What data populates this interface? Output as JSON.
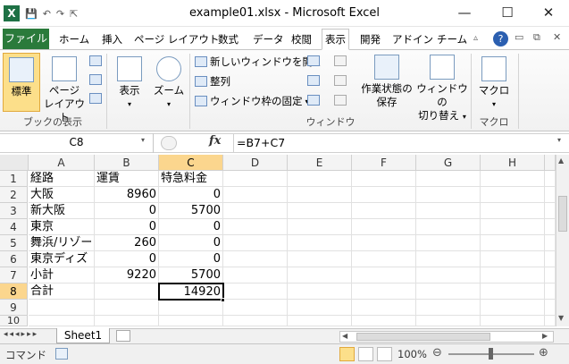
{
  "window": {
    "title": "example01.xlsx - Microsoft Excel"
  },
  "qat": {
    "logo": "X",
    "save": "💾",
    "undo": "↶",
    "redo": "↷",
    "cursor": "⇱"
  },
  "tabs": [
    "ファイル",
    "ホーム",
    "挿入",
    "ページ レイアウト",
    "数式",
    "データ",
    "校閲",
    "表示",
    "開発",
    "アドイン",
    "チーム"
  ],
  "active_tab": "表示",
  "ribbon": {
    "views": {
      "normal": "標準",
      "page_layout_1": "ページ",
      "page_layout_2": "レイアウト",
      "group": "ブックの表示"
    },
    "show": {
      "label": "表示"
    },
    "zoom": {
      "label": "ズーム"
    },
    "window": {
      "new_window": "新しいウィンドウを開く",
      "arrange": "整列",
      "freeze": "ウィンドウ枠の固定",
      "save_ws_1": "作業状態の",
      "save_ws_2": "保存",
      "switch_1": "ウィンドウの",
      "switch_2": "切り替え",
      "group": "ウィンドウ"
    },
    "macro": {
      "label": "マクロ",
      "group": "マクロ"
    }
  },
  "formula": {
    "name_box": "C8",
    "fx": "fx",
    "content": "=B7+C7"
  },
  "columns": [
    "A",
    "B",
    "C",
    "D",
    "E",
    "F",
    "G",
    "H"
  ],
  "rows": [
    "1",
    "2",
    "3",
    "4",
    "5",
    "6",
    "7",
    "8",
    "9",
    "10"
  ],
  "cells": {
    "a1": "経路",
    "b1": "運賃",
    "c1": "特急料金",
    "a2": "大阪",
    "b2": "8960",
    "c2": "0",
    "a3": "新大阪",
    "b3": "0",
    "c3": "5700",
    "a4": "東京",
    "b4": "0",
    "c4": "0",
    "a5": "舞浜/リゾー",
    "b5": "260",
    "c5": "0",
    "a6": "東京ディズ",
    "b6": "0",
    "c6": "0",
    "a7": "小計",
    "b7": "9220",
    "c7": "5700",
    "a8": "合計",
    "c8": "14920"
  },
  "sheet": {
    "tab": "Sheet1"
  },
  "status": {
    "mode": "コマンド",
    "zoom": "100%"
  }
}
